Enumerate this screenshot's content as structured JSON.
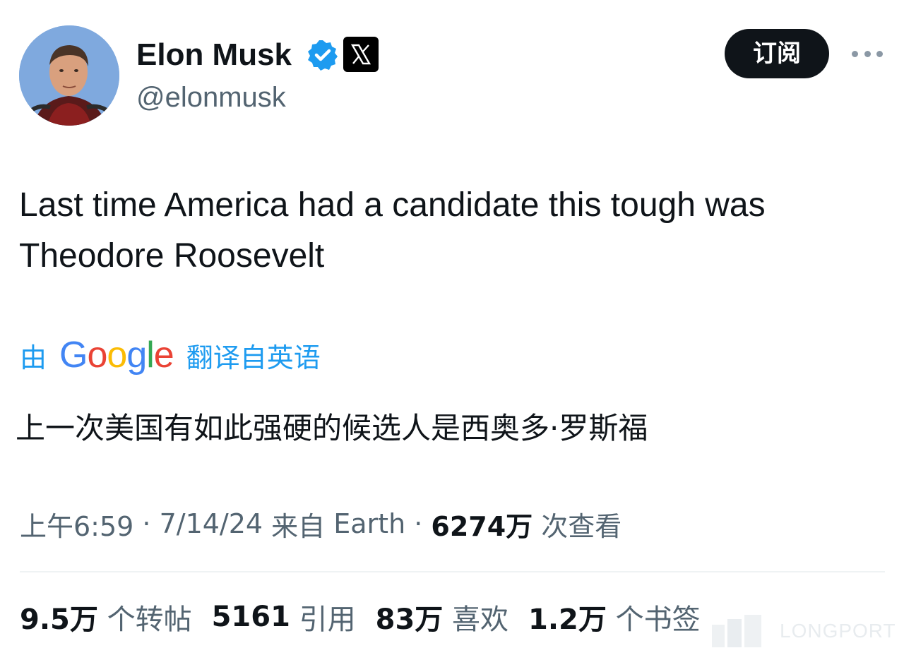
{
  "author": {
    "display_name": "Elon Musk",
    "handle": "@elonmusk",
    "verified_icon": "verified-badge-icon",
    "affiliation_icon": "x-logo-icon"
  },
  "actions": {
    "subscribe_label": "订阅",
    "more_icon": "more-horizontal-icon"
  },
  "tweet": {
    "text": "Last time America had a candidate this tough was Theodore Roosevelt"
  },
  "translation": {
    "prefix": "由",
    "provider": "Google",
    "suffix": "翻译自英语",
    "translated_text": "上一次美国有如此强硬的候选人是西奥多·罗斯福"
  },
  "meta": {
    "time": "上午6:59",
    "separator1": " · ",
    "date": "7/14/24",
    "source_prefix": " 来自 ",
    "source": "Earth",
    "separator2": " · ",
    "views": "6274万",
    "views_label": " 次查看"
  },
  "stats": [
    {
      "value": "9.5万",
      "label": " 个转帖"
    },
    {
      "value": "5161",
      "label": " 引用"
    },
    {
      "value": "83万",
      "label": " 喜欢"
    },
    {
      "value": "1.2万",
      "label": " 个书签"
    }
  ],
  "watermark": {
    "text": "LONGPORT"
  },
  "colors": {
    "accent": "#1d9bf0",
    "text_primary": "#0f1419",
    "text_secondary": "#536471",
    "button_bg": "#0f1419"
  }
}
